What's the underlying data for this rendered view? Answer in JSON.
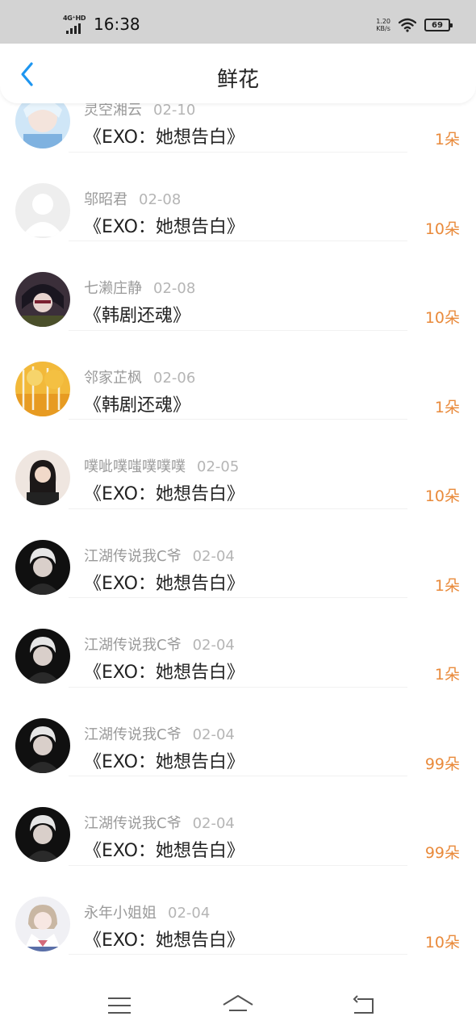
{
  "status_bar": {
    "network": "4G⁺HD",
    "time": "16:38",
    "speed_value": "1.20",
    "speed_unit": "KB/s",
    "battery": "69",
    "icons": [
      "signal-icon",
      "wifi-icon",
      "battery-icon"
    ]
  },
  "header": {
    "title": "鲜花",
    "back_icon": "chevron-left-icon",
    "accent_color": "#1e96f0"
  },
  "list": {
    "count_color": "#e98a3b",
    "items": [
      {
        "user": "灵空湘云",
        "date": "02-10",
        "book": "《EXO：她想告白》",
        "count": "1朵",
        "avatar": "anime-avatar-blue"
      },
      {
        "user": "邬昭君",
        "date": "02-08",
        "book": "《EXO：她想告白》",
        "count": "10朵",
        "avatar": "default-avatar"
      },
      {
        "user": "七濑庄静",
        "date": "02-08",
        "book": "《韩剧还魂》",
        "count": "10朵",
        "avatar": "anime-avatar-dark"
      },
      {
        "user": "邻家芷枫",
        "date": "02-06",
        "book": "《韩剧还魂》",
        "count": "1朵",
        "avatar": "autumn-landscape-avatar"
      },
      {
        "user": "噗呲噗嗤噗噗噗",
        "date": "02-05",
        "book": "《EXO：她想告白》",
        "count": "10朵",
        "avatar": "girl-photo-avatar"
      },
      {
        "user": "江湖传说我C爷",
        "date": "02-04",
        "book": "《EXO：她想告白》",
        "count": "1朵",
        "avatar": "person-photo-avatar"
      },
      {
        "user": "江湖传说我C爷",
        "date": "02-04",
        "book": "《EXO：她想告白》",
        "count": "1朵",
        "avatar": "person-photo-avatar"
      },
      {
        "user": "江湖传说我C爷",
        "date": "02-04",
        "book": "《EXO：她想告白》",
        "count": "99朵",
        "avatar": "person-photo-avatar"
      },
      {
        "user": "江湖传说我C爷",
        "date": "02-04",
        "book": "《EXO：她想告白》",
        "count": "99朵",
        "avatar": "person-photo-avatar"
      },
      {
        "user": "永年小姐姐",
        "date": "02-04",
        "book": "《EXO：她想告白》",
        "count": "10朵",
        "avatar": "anime-avatar-sailor"
      }
    ]
  },
  "nav_bar": {
    "icons": [
      "menu-icon",
      "home-icon",
      "back-icon"
    ]
  }
}
